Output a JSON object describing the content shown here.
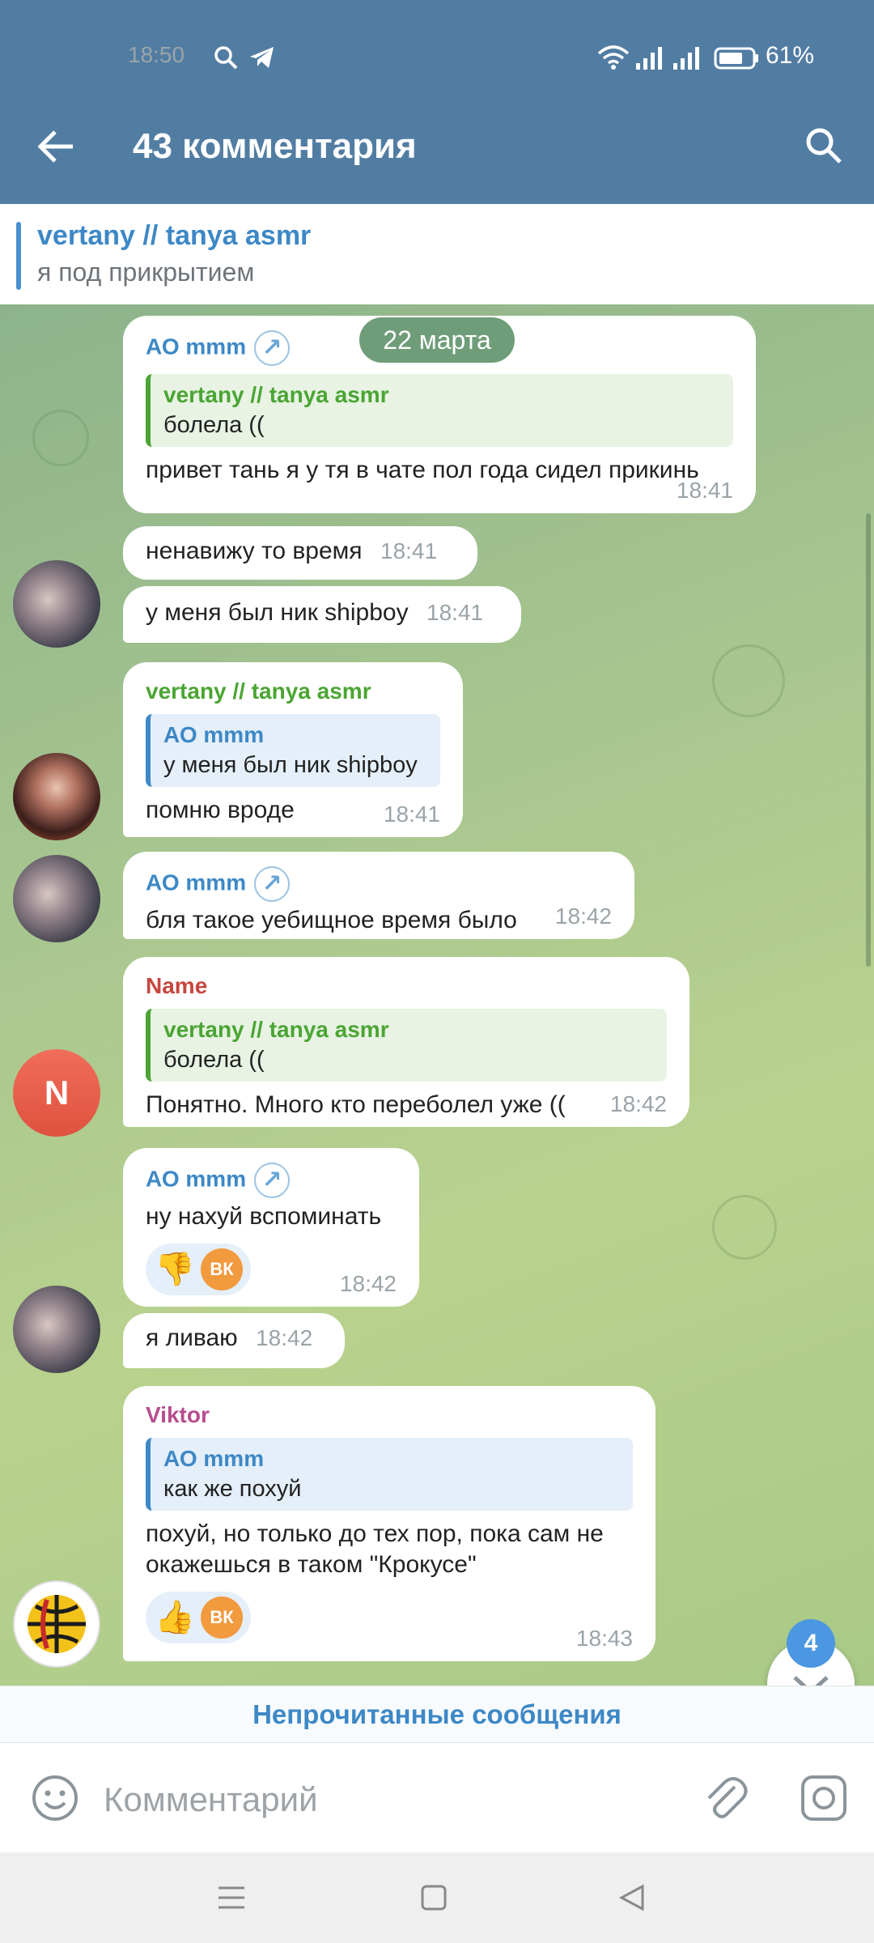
{
  "status_bar": {
    "time": "18:50",
    "battery": "61%"
  },
  "header": {
    "title": "43 комментария"
  },
  "context": {
    "name": "vertany // tanya asmr",
    "text": "я под прикрытием"
  },
  "date_pill": "22 марта",
  "messages": [
    {
      "sender": "АО mmm",
      "quote_name": "vertany // tanya asmr",
      "quote_text": "болела ((",
      "text": "привет тань я у тя в чате пол года сидел прикинь",
      "time": "18:41"
    },
    {
      "text": "ненавижу то время",
      "time": "18:41"
    },
    {
      "text": "у меня был ник shipboy",
      "time": "18:41"
    },
    {
      "sender": "vertany // tanya asmr",
      "quote_name": "АО mmm",
      "quote_text": "у меня был ник shipboy",
      "text": "помню вроде",
      "time": "18:41"
    },
    {
      "sender": "АО mmm",
      "text": "бля такое уебищное время было",
      "time": "18:42"
    },
    {
      "sender": "Name",
      "avatar_letter": "N",
      "quote_name": "vertany // tanya asmr",
      "quote_text": "болела ((",
      "text": "Понятно. Много кто переболел уже ((",
      "time": "18:42"
    },
    {
      "sender": "АО mmm",
      "text": "ну нахуй вспоминать",
      "reaction_emoji": "👎",
      "reaction_badge": "ВК",
      "time": "18:42"
    },
    {
      "text": "я ливаю",
      "time": "18:42"
    },
    {
      "sender": "Viktor",
      "quote_name": "АО mmm",
      "quote_text": "как же похуй",
      "text": "похуй, но только до тех пор, пока сам не окажешься в таком \"Крокусе\"",
      "reaction_emoji": "👍",
      "reaction_badge": "ВК",
      "time": "18:43"
    }
  ],
  "unread": {
    "label": "Непрочитанные сообщения",
    "count": "4"
  },
  "input": {
    "placeholder": "Комментарий"
  },
  "colors": {
    "header": "#527da3",
    "accent": "#3d88c6",
    "green_name": "#4aa533"
  },
  "icons": [
    "search-icon",
    "telegram-icon",
    "wifi-icon",
    "signal-icon",
    "battery-icon",
    "back-arrow-icon",
    "emoji-icon",
    "attach-icon",
    "camera-icon",
    "chevron-down-icon"
  ]
}
